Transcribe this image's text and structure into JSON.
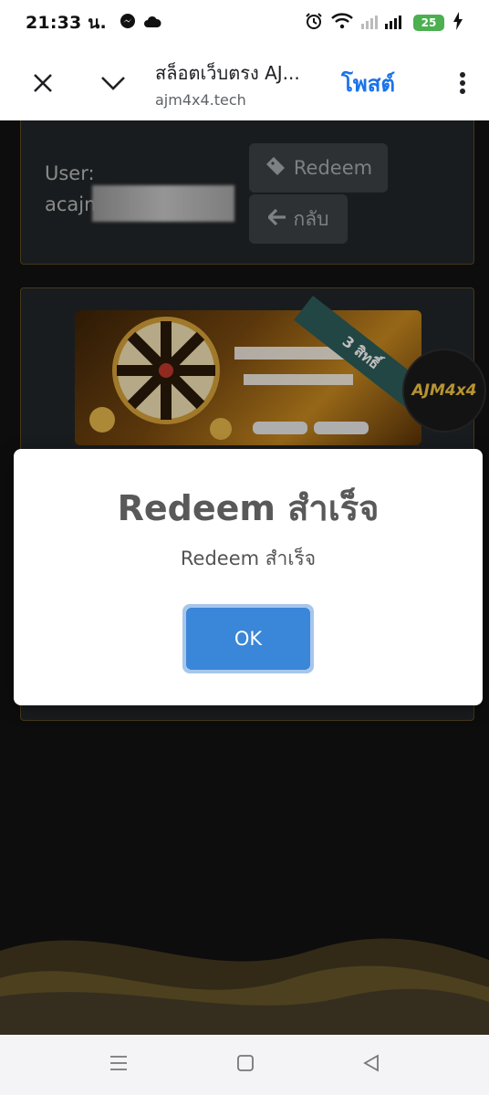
{
  "status_bar": {
    "time": "21:33 น.",
    "battery": "25",
    "icons": [
      "messenger-icon",
      "cloud-icon",
      "alarm-icon",
      "wifi-icon",
      "signal-icon",
      "battery-icon",
      "charging-icon"
    ]
  },
  "browser": {
    "title": "สล็อตเว็บตรง AJ...",
    "url": "ajm4x4.tech",
    "post_label": "โพสต์",
    "accent_color": "#1a73e8"
  },
  "user_card": {
    "user_label": "User:",
    "username_visible": "acajn",
    "redeem_label": "Redeem",
    "back_label": "กลับ"
  },
  "promo": {
    "ribbon_text": "3 สิทธิ์",
    "logo_text": "AJM4x4"
  },
  "modal": {
    "title": "Redeem สำเร็จ",
    "text": "Redeem สำเร็จ",
    "ok_label": "OK",
    "ok_color": "#3a86d8"
  },
  "nav_bar": {
    "icons": [
      "menu-icon",
      "home-icon",
      "back-icon"
    ]
  }
}
